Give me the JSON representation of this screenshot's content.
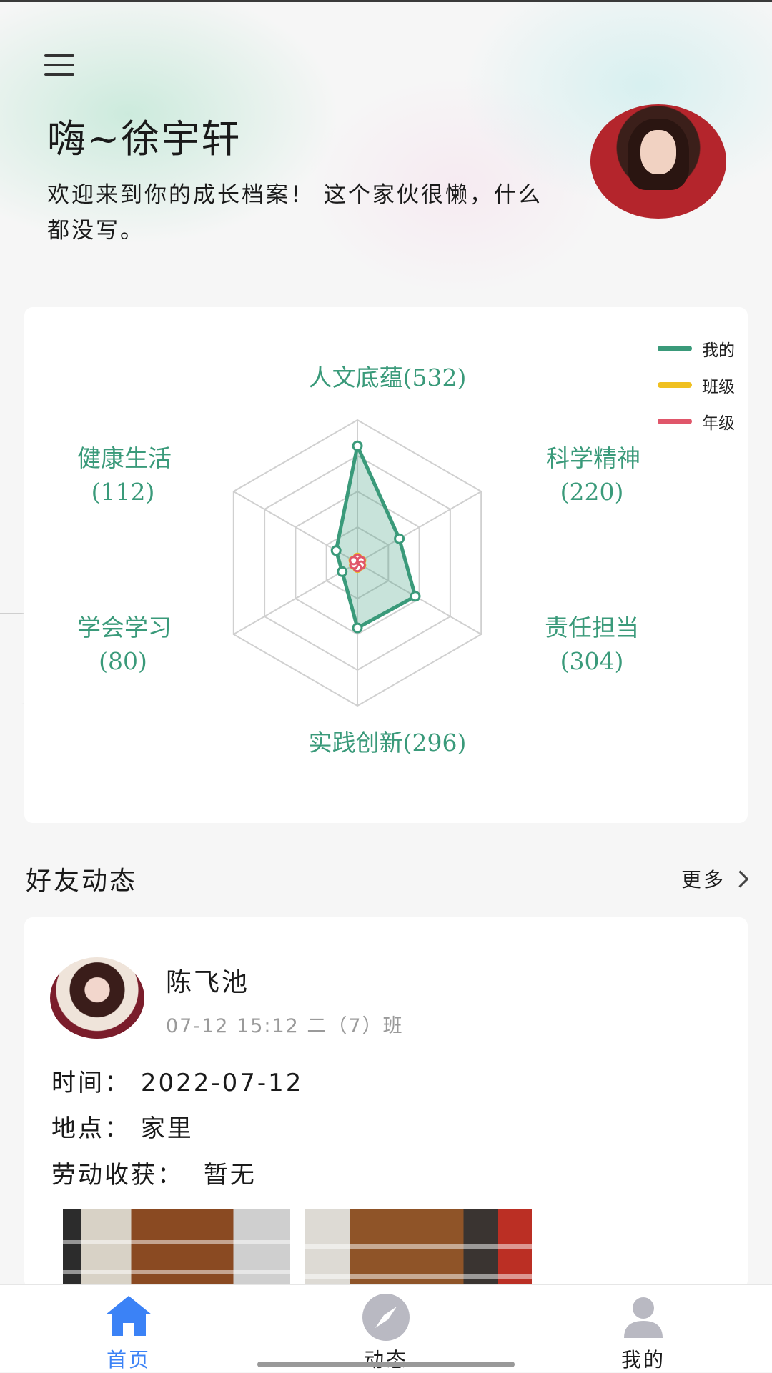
{
  "header": {
    "greeting": "嗨~徐宇轩",
    "welcome": "欢迎来到你的成长档案！ 这个家伙很懒，什么都没写。"
  },
  "radar": {
    "legend": [
      {
        "label": "我的",
        "color": "#3a9a7a"
      },
      {
        "label": "班级",
        "color": "#f0c020"
      },
      {
        "label": "年级",
        "color": "#e0566a"
      }
    ],
    "axes": [
      {
        "name": "人文底蕴",
        "value": "(532)"
      },
      {
        "name": "科学精神",
        "value": "(220)"
      },
      {
        "name": "责任担当",
        "value": "(304)"
      },
      {
        "name": "实践创新",
        "value": "(296)"
      },
      {
        "name": "学会学习",
        "value": "(80)"
      },
      {
        "name": "健康生活",
        "value": "(112)"
      }
    ]
  },
  "chart_data": {
    "type": "radar",
    "categories": [
      "人文底蕴",
      "科学精神",
      "责任担当",
      "实践创新",
      "学会学习",
      "健康生活"
    ],
    "max": 650,
    "series": [
      {
        "name": "我的",
        "values": [
          532,
          220,
          304,
          296,
          80,
          112
        ],
        "color": "#3a9a7a"
      },
      {
        "name": "班级",
        "values": [
          25,
          22,
          22,
          25,
          20,
          22
        ],
        "color": "#f0c020"
      },
      {
        "name": "年级",
        "values": [
          22,
          20,
          20,
          22,
          18,
          20
        ],
        "color": "#e0566a"
      }
    ]
  },
  "friends": {
    "title": "好友动态",
    "more": "更多"
  },
  "post": {
    "name": "陈飞池",
    "meta": "07-12 15:12 二（7）班",
    "time_label": "时间：",
    "time_value": "2022-07-12",
    "place_label": "地点：",
    "place_value": "家里",
    "harvest_label": "劳动收获：",
    "harvest_value": "暂无"
  },
  "tabs": [
    {
      "label": "首页",
      "active": true
    },
    {
      "label": "动态",
      "active": false
    },
    {
      "label": "我的",
      "active": false
    }
  ],
  "colors": {
    "accent": "#3a9a7a",
    "tab_active": "#3b82f6",
    "tab_inactive": "#333333"
  }
}
